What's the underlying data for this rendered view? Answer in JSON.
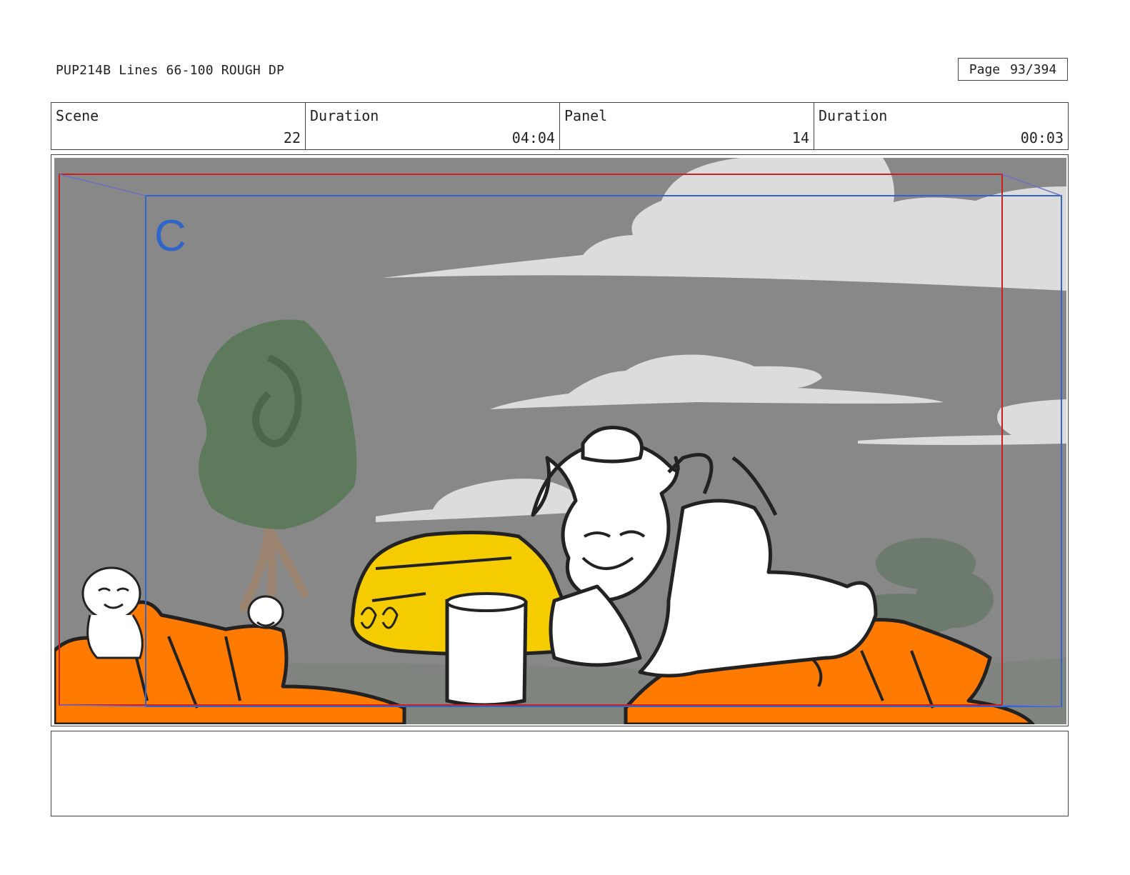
{
  "header": {
    "title": "PUP214B Lines 66-100 ROUGH DP",
    "page_label": "Page",
    "page_value": "93/394"
  },
  "info": {
    "scene_label": "Scene",
    "scene_value": "22",
    "scene_duration_label": "Duration",
    "scene_duration_value": "04:04",
    "panel_label": "Panel",
    "panel_value": "14",
    "panel_duration_label": "Duration",
    "panel_duration_value": "00:03"
  },
  "panel": {
    "camera_letter": "C",
    "colors": {
      "sky": "#888888",
      "cloud": "#dcdcdc",
      "ground": "#7f847f",
      "tree_foliage": "#5e7a5c",
      "tree_trunk": "#9a8470",
      "truck": "#f5cc00",
      "debris": "#ff7a00",
      "frame_red": "#cc1f1f",
      "frame_blue": "#2f66c8"
    }
  },
  "notes": {
    "text": ""
  }
}
